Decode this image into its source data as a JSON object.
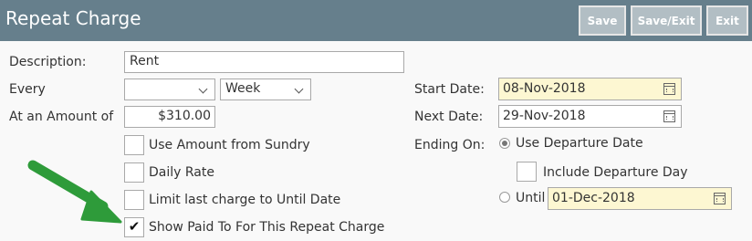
{
  "window": {
    "title": "Repeat Charge",
    "buttons": {
      "save": "Save",
      "save_exit": "Save/Exit",
      "exit": "Exit"
    }
  },
  "form": {
    "description": {
      "label": "Description:",
      "value": "Rent"
    },
    "every": {
      "label": "Every",
      "number_value": "",
      "unit_value": "Week"
    },
    "amount": {
      "label": "At an Amount of",
      "value": "$310.00"
    },
    "checkboxes": {
      "use_amount_from_sundry": {
        "label": "Use Amount from Sundry",
        "checked": false
      },
      "daily_rate": {
        "label": "Daily Rate",
        "checked": false
      },
      "limit_last_charge": {
        "label": "Limit last charge to Until Date",
        "checked": false
      },
      "show_paid_to": {
        "label": "Show Paid To For This Repeat Charge",
        "checked": true,
        "mark": "✔"
      }
    },
    "start_date": {
      "label": "Start Date:",
      "value": "08-Nov-2018"
    },
    "next_date": {
      "label": "Next Date:",
      "value": "29-Nov-2018"
    },
    "ending_on": {
      "label": "Ending On:",
      "use_departure_date": {
        "label": "Use Departure Date",
        "selected": true
      },
      "include_departure_day": {
        "label": "Include Departure Day",
        "checked": false
      },
      "until": {
        "label": "Until",
        "selected": false,
        "value": "01-Dec-2018"
      }
    }
  },
  "colors": {
    "titlebar": "#667f8c",
    "date_highlight": "#fdf7d2",
    "arrow": "#2e9b3a"
  }
}
